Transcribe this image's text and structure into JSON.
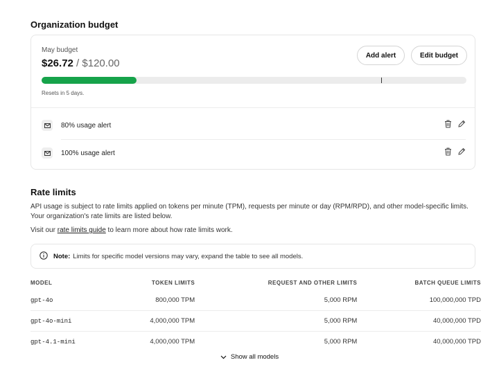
{
  "budget": {
    "section_title": "Organization budget",
    "label": "May budget",
    "spent": "$26.72",
    "separator": " / ",
    "total": "$120.00",
    "usage_fraction": 0.2227,
    "marker_fraction": 0.8,
    "bar_color": "#16a34a",
    "add_alert_label": "Add alert",
    "edit_budget_label": "Edit budget",
    "resets_text": "Resets in 5 days.",
    "alerts": [
      {
        "label": "80% usage alert",
        "icon": "mail-icon"
      },
      {
        "label": "100% usage alert",
        "icon": "mail-icon"
      }
    ]
  },
  "rate_limits": {
    "section_title": "Rate limits",
    "description_line1": "API usage is subject to rate limits applied on tokens per minute (TPM), requests per minute or day (RPM/RPD), and other model-specific limits.",
    "description_line2": "Your organization's rate limits are listed below.",
    "visit_prefix": "Visit our ",
    "guide_link": "rate limits guide",
    "visit_suffix": " to learn more about how rate limits work.",
    "note_bold": "Note:",
    "note_text": "Limits for specific model versions may vary, expand the table to see all models.",
    "columns": [
      "MODEL",
      "TOKEN LIMITS",
      "REQUEST AND OTHER LIMITS",
      "BATCH QUEUE LIMITS"
    ],
    "rows": [
      {
        "model": "gpt-4o",
        "token": "800,000 TPM",
        "request": "5,000 RPM",
        "batch": "100,000,000 TPD"
      },
      {
        "model": "gpt-4o-mini",
        "token": "4,000,000 TPM",
        "request": "5,000 RPM",
        "batch": "40,000,000 TPD"
      },
      {
        "model": "gpt-4.1-mini",
        "token": "4,000,000 TPM",
        "request": "5,000 RPM",
        "batch": "40,000,000 TPD"
      }
    ],
    "show_all_label": "Show all models"
  }
}
